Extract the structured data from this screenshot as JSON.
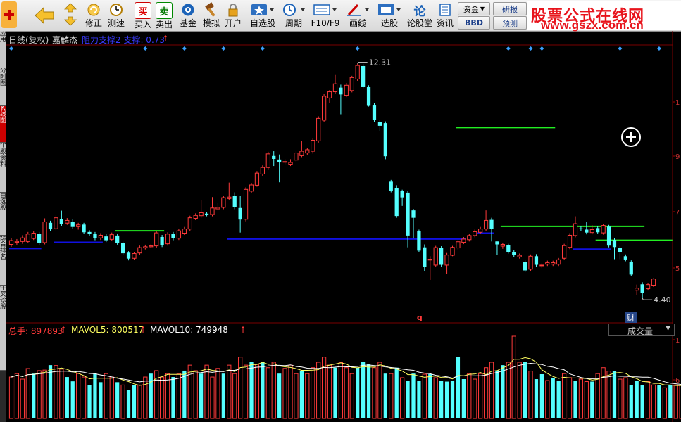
{
  "toolbar": {
    "buttons": [
      {
        "label": "",
        "icon": "back-icon"
      },
      {
        "label": "修正",
        "icon": "refresh-icon"
      },
      {
        "label": "测速",
        "icon": "clock-icon"
      },
      {
        "label": "买入",
        "icon": "buy-icon",
        "glyph": "买"
      },
      {
        "label": "卖出",
        "icon": "sell-icon",
        "glyph": "卖"
      },
      {
        "label": "基金",
        "icon": "fund-icon"
      },
      {
        "label": "模拟",
        "icon": "hammer-icon"
      },
      {
        "label": "开户",
        "icon": "lock-icon"
      },
      {
        "label": "自选股",
        "icon": "star-icon"
      },
      {
        "label": "周期",
        "icon": "period-icon"
      },
      {
        "label": "F10/F9",
        "icon": "f10-icon"
      },
      {
        "label": "画线",
        "icon": "pen-icon"
      },
      {
        "label": "选股",
        "icon": "select-icon"
      },
      {
        "label": "论股堂",
        "icon": "forum-icon",
        "glyph": "论"
      },
      {
        "label": "资讯",
        "icon": "news-icon"
      }
    ],
    "side_buttons": {
      "capital": "资金",
      "bbd": "BBD",
      "research": "研报",
      "forecast": "预测"
    }
  },
  "brand": {
    "title": "股票公式在线网",
    "url": "www.gszx.com.cn"
  },
  "left_tabs": [
    "应用",
    "分时图",
    "K线图",
    "个股资料",
    "自选股",
    "综合排名",
    "牛叉诊股"
  ],
  "chart_header": {
    "period": "日线(复权)",
    "name": "嘉麟杰",
    "indicator": "阻力支撑2 支撑: 0.73",
    "arrow": "↑"
  },
  "price_labels": {
    "high": "12.31",
    "low": "4.40",
    "marker": "q",
    "finance_badge": "财"
  },
  "volume_header": {
    "total_label": "总手: 897893",
    "mavol5": "MAVOL5: 800517",
    "mavol10": "MAVOL10: 749948",
    "arrow": "↑"
  },
  "volume_dropdown": "成交量",
  "y_axis": {
    "price_ticks": [
      "1",
      "9",
      "7",
      "5"
    ],
    "volume_ticks": [
      "1",
      "6"
    ]
  },
  "colors": {
    "up": "#ff3a3a",
    "down": "#54ffff",
    "support": "#1010e0",
    "resistance": "#22ee22",
    "background": "#000000",
    "brand_red": "#e8141c"
  },
  "chart_data": {
    "type": "candlestick",
    "price_range": [
      4.0,
      12.8
    ],
    "high": 12.31,
    "low": 4.4,
    "candles": [
      [
        6.2,
        6.33,
        6.12,
        6.41
      ],
      [
        6.27,
        6.3,
        6.19,
        6.38
      ],
      [
        6.3,
        6.42,
        6.22,
        6.51
      ],
      [
        6.3,
        6.55,
        6.26,
        6.62
      ],
      [
        6.4,
        6.58,
        6.35,
        6.66
      ],
      [
        6.56,
        6.26,
        6.18,
        6.62
      ],
      [
        6.26,
        6.96,
        6.2,
        7.08
      ],
      [
        6.93,
        6.71,
        6.65,
        7.0
      ],
      [
        6.73,
        7.1,
        6.68,
        7.18
      ],
      [
        7.05,
        6.9,
        6.82,
        7.34
      ],
      [
        6.92,
        7.01,
        6.86,
        7.09
      ],
      [
        6.95,
        6.79,
        6.73,
        7.06
      ],
      [
        6.8,
        6.86,
        6.7,
        6.93
      ],
      [
        6.87,
        6.61,
        6.55,
        6.93
      ],
      [
        6.62,
        6.56,
        6.5,
        6.68
      ],
      [
        6.56,
        6.41,
        6.34,
        6.62
      ],
      [
        6.42,
        6.51,
        6.35,
        6.58
      ],
      [
        6.47,
        6.34,
        6.28,
        6.55
      ],
      [
        6.37,
        6.53,
        6.31,
        6.6
      ],
      [
        6.5,
        6.25,
        6.19,
        6.57
      ],
      [
        6.25,
        5.9,
        5.84,
        6.29
      ],
      [
        5.92,
        5.72,
        5.66,
        5.97
      ],
      [
        5.73,
        5.89,
        5.67,
        5.95
      ],
      [
        5.91,
        6.09,
        5.85,
        6.16
      ],
      [
        6.08,
        6.12,
        6.03,
        6.19
      ],
      [
        6.12,
        6.15,
        6.07,
        6.2
      ],
      [
        6.15,
        6.59,
        6.09,
        6.66
      ],
      [
        6.45,
        6.18,
        6.11,
        6.52
      ],
      [
        6.22,
        6.55,
        6.16,
        6.61
      ],
      [
        6.55,
        6.41,
        6.34,
        6.62
      ],
      [
        6.41,
        6.66,
        6.35,
        6.73
      ],
      [
        6.58,
        6.72,
        6.52,
        6.79
      ],
      [
        6.72,
        7.1,
        6.66,
        7.17
      ],
      [
        7.08,
        7.18,
        7.02,
        7.25
      ],
      [
        7.17,
        7.27,
        7.1,
        7.7
      ],
      [
        7.24,
        7.21,
        7.15,
        7.3
      ],
      [
        7.21,
        7.43,
        7.15,
        7.8
      ],
      [
        7.4,
        7.45,
        7.35,
        7.6
      ],
      [
        7.45,
        7.78,
        7.39,
        7.85
      ],
      [
        7.75,
        7.8,
        7.69,
        8.29
      ],
      [
        7.85,
        7.45,
        7.39,
        7.96
      ],
      [
        7.43,
        7.04,
        6.6,
        7.84
      ],
      [
        7.05,
        8.06,
        6.98,
        8.13
      ],
      [
        8.0,
        8.21,
        7.94,
        8.28
      ],
      [
        8.2,
        8.61,
        8.15,
        8.68
      ],
      [
        8.58,
        8.8,
        8.52,
        8.87
      ],
      [
        8.8,
        9.26,
        8.74,
        9.33
      ],
      [
        9.19,
        9.09,
        8.85,
        9.35
      ],
      [
        9.07,
        8.97,
        8.3,
        9.24
      ],
      [
        8.99,
        9.0,
        8.91,
        9.08
      ],
      [
        8.91,
        8.97,
        8.85,
        9.08
      ],
      [
        9.05,
        9.29,
        8.98,
        9.35
      ],
      [
        9.2,
        9.35,
        9.15,
        9.7
      ],
      [
        9.29,
        9.4,
        9.21,
        9.46
      ],
      [
        9.35,
        9.72,
        9.27,
        9.8
      ],
      [
        9.7,
        10.46,
        9.64,
        10.53
      ],
      [
        10.4,
        11.21,
        10.34,
        11.28
      ],
      [
        11.15,
        11.36,
        10.98,
        11.42
      ],
      [
        11.36,
        11.63,
        11.3,
        11.95
      ],
      [
        11.5,
        11.27,
        10.6,
        11.6
      ],
      [
        11.24,
        11.58,
        11.18,
        11.66
      ],
      [
        11.4,
        11.84,
        11.34,
        11.9
      ],
      [
        11.79,
        12.25,
        11.73,
        12.31
      ],
      [
        12.23,
        11.54,
        11.48,
        12.3
      ],
      [
        11.52,
        10.91,
        10.86,
        11.58
      ],
      [
        10.92,
        10.4,
        10.33,
        10.98
      ],
      [
        10.35,
        10.21,
        10.04,
        10.4
      ],
      [
        10.3,
        9.18,
        9.08,
        10.36
      ],
      [
        8.32,
        8.02,
        7.96,
        8.38
      ],
      [
        8.1,
        7.16,
        7.1,
        8.2
      ],
      [
        8.0,
        7.79,
        7.5,
        8.05
      ],
      [
        7.95,
        6.5,
        6.1,
        8.0
      ],
      [
        7.35,
        7.1,
        6.4,
        7.4
      ],
      [
        6.65,
        5.99,
        5.93,
        6.7
      ],
      [
        6.1,
        5.45,
        5.3,
        6.2
      ],
      [
        5.67,
        5.7,
        5.0,
        5.8
      ],
      [
        5.5,
        6.09,
        5.44,
        6.15
      ],
      [
        6.08,
        5.51,
        5.45,
        6.14
      ],
      [
        5.5,
        5.84,
        5.2,
        5.91
      ],
      [
        5.83,
        6.1,
        5.8,
        6.15
      ],
      [
        6.08,
        6.29,
        6.02,
        6.36
      ],
      [
        6.27,
        6.38,
        6.21,
        6.45
      ],
      [
        6.36,
        6.5,
        6.3,
        6.56
      ],
      [
        6.5,
        6.63,
        6.44,
        6.7
      ],
      [
        6.61,
        6.72,
        6.55,
        6.79
      ],
      [
        6.72,
        7.01,
        6.66,
        7.35
      ],
      [
        7.03,
        6.72,
        6.3,
        7.1
      ],
      [
        6.3,
        6.2,
        5.85,
        6.3
      ],
      [
        6.14,
        6.2,
        6.05,
        6.26
      ],
      [
        6.17,
        5.95,
        5.89,
        6.22
      ],
      [
        5.95,
        5.84,
        5.78,
        6.01
      ],
      [
        5.78,
        5.83,
        5.72,
        5.89
      ],
      [
        5.6,
        5.32,
        5.26,
        5.66
      ],
      [
        5.36,
        5.8,
        5.3,
        5.86
      ],
      [
        5.8,
        5.51,
        5.45,
        5.87
      ],
      [
        5.48,
        5.5,
        5.4,
        5.56
      ],
      [
        5.53,
        5.58,
        5.47,
        5.65
      ],
      [
        5.53,
        5.58,
        5.47,
        5.65
      ],
      [
        5.53,
        5.68,
        5.47,
        5.74
      ],
      [
        5.73,
        6.16,
        5.67,
        6.22
      ],
      [
        6.1,
        6.51,
        6.04,
        6.58
      ],
      [
        6.5,
        6.9,
        6.44,
        7.15
      ],
      [
        6.74,
        6.72,
        6.66,
        6.82
      ],
      [
        6.7,
        6.6,
        6.54,
        6.95
      ],
      [
        6.6,
        6.7,
        6.54,
        6.85
      ],
      [
        6.75,
        6.61,
        6.55,
        6.81
      ],
      [
        6.59,
        6.84,
        6.53,
        6.9
      ],
      [
        6.8,
        6.16,
        6.1,
        6.86
      ],
      [
        6.35,
        6.11,
        5.7,
        6.42
      ],
      [
        6.08,
        5.94,
        5.7,
        6.14
      ],
      [
        5.8,
        5.69,
        5.63,
        5.86
      ],
      [
        5.6,
        5.18,
        5.12,
        5.66
      ],
      [
        4.65,
        4.72,
        4.5,
        4.84
      ],
      [
        4.85,
        4.55,
        4.4,
        4.92
      ],
      [
        4.7,
        4.84,
        4.64,
        4.9
      ],
      [
        4.82,
        5.03,
        4.76,
        5.06
      ]
    ],
    "support_lines": [
      {
        "from": 0,
        "to": 5,
        "price": 6.06
      },
      {
        "from": 8,
        "to": 16,
        "price": 6.27
      },
      {
        "from": 39,
        "to": 81,
        "price": 6.38
      },
      {
        "from": 83,
        "to": 86,
        "price": 6.58
      },
      {
        "from": 101,
        "to": 107,
        "price": 6.04
      }
    ],
    "resistance_lines": [
      {
        "from": 19,
        "to": 27,
        "price": 6.66
      },
      {
        "from": 80,
        "to": 97,
        "price": 10.15
      },
      {
        "from": 88,
        "to": 113,
        "price": 6.81
      },
      {
        "from": 105,
        "to": 118,
        "price": 6.34
      }
    ],
    "volume_range": [
      0,
      1300000
    ],
    "volume": [
      [
        655000,
        1
      ],
      [
        709000,
        1
      ],
      [
        622000,
        1
      ],
      [
        789000,
        1
      ],
      [
        709000,
        0
      ],
      [
        756000,
        1
      ],
      [
        765000,
        1
      ],
      [
        843000,
        0
      ],
      [
        837000,
        1
      ],
      [
        780000,
        1
      ],
      [
        655000,
        0
      ],
      [
        587000,
        0
      ],
      [
        709000,
        1
      ],
      [
        655000,
        1
      ],
      [
        529000,
        0
      ],
      [
        709000,
        0
      ],
      [
        574000,
        0
      ],
      [
        709000,
        1
      ],
      [
        655000,
        1
      ],
      [
        574000,
        0
      ],
      [
        529000,
        1
      ],
      [
        448000,
        0
      ],
      [
        529000,
        0
      ],
      [
        529000,
        1
      ],
      [
        655000,
        1
      ],
      [
        709000,
        0
      ],
      [
        756000,
        1
      ],
      [
        655000,
        1
      ],
      [
        709000,
        1
      ],
      [
        655000,
        0
      ],
      [
        709000,
        1
      ],
      [
        756000,
        0
      ],
      [
        843000,
        1
      ],
      [
        756000,
        1
      ],
      [
        709000,
        0
      ],
      [
        843000,
        1
      ],
      [
        655000,
        1
      ],
      [
        791000,
        1
      ],
      [
        709000,
        0
      ],
      [
        843000,
        1
      ],
      [
        709000,
        1
      ],
      [
        970000,
        1
      ],
      [
        843000,
        1
      ],
      [
        889000,
        0
      ],
      [
        855000,
        1
      ],
      [
        889000,
        0
      ],
      [
        803000,
        1
      ],
      [
        889000,
        1
      ],
      [
        709000,
        0
      ],
      [
        791000,
        1
      ],
      [
        843000,
        1
      ],
      [
        709000,
        1
      ],
      [
        752000,
        0
      ],
      [
        709000,
        1
      ],
      [
        803000,
        1
      ],
      [
        889000,
        1
      ],
      [
        970000,
        1
      ],
      [
        843000,
        1
      ],
      [
        803000,
        0
      ],
      [
        889000,
        1
      ],
      [
        803000,
        1
      ],
      [
        709000,
        1
      ],
      [
        803000,
        0
      ],
      [
        889000,
        0
      ],
      [
        855000,
        0
      ],
      [
        803000,
        1
      ],
      [
        889000,
        1
      ],
      [
        709000,
        0
      ],
      [
        709000,
        1
      ],
      [
        803000,
        0
      ],
      [
        645000,
        1
      ],
      [
        600000,
        0
      ],
      [
        709000,
        0
      ],
      [
        600000,
        0
      ],
      [
        700000,
        1
      ],
      [
        700000,
        0
      ],
      [
        645000,
        1
      ],
      [
        600000,
        0
      ],
      [
        583000,
        0
      ],
      [
        600000,
        0
      ],
      [
        970000,
        0
      ],
      [
        622000,
        0
      ],
      [
        709000,
        1
      ],
      [
        622000,
        1
      ],
      [
        709000,
        1
      ],
      [
        803000,
        1
      ],
      [
        889000,
        1
      ],
      [
        760000,
        0
      ],
      [
        843000,
        0
      ],
      [
        889000,
        1
      ],
      [
        1300000,
        1
      ],
      [
        889000,
        1
      ],
      [
        889000,
        0
      ],
      [
        749000,
        1
      ],
      [
        622000,
        0
      ],
      [
        700000,
        0
      ],
      [
        600000,
        1
      ],
      [
        645000,
        0
      ],
      [
        600000,
        0
      ],
      [
        709000,
        1
      ],
      [
        645000,
        1
      ],
      [
        600000,
        0
      ],
      [
        622000,
        1
      ],
      [
        583000,
        1
      ],
      [
        583000,
        0
      ],
      [
        709000,
        1
      ],
      [
        803000,
        1
      ],
      [
        749000,
        1
      ],
      [
        749000,
        0
      ],
      [
        622000,
        1
      ],
      [
        645000,
        1
      ],
      [
        530000,
        0
      ],
      [
        600000,
        0
      ],
      [
        530000,
        0
      ],
      [
        583000,
        1
      ],
      [
        530000,
        1
      ],
      [
        530000,
        0
      ],
      [
        485000,
        1
      ],
      [
        530000,
        0
      ],
      [
        530000,
        1
      ],
      [
        530000,
        1
      ]
    ]
  }
}
